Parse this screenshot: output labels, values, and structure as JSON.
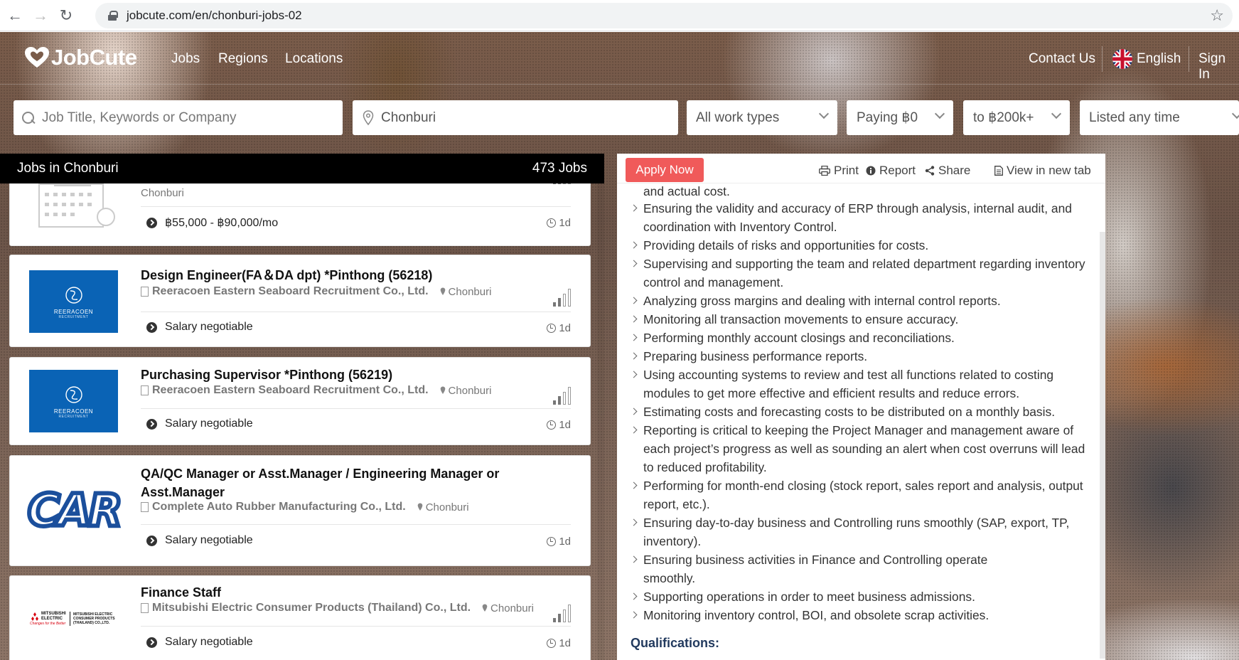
{
  "browser": {
    "url": "jobcute.com/en/chonburi-jobs-02",
    "back_icon": "←",
    "forward_icon": "→",
    "reload_icon": "↻",
    "star_icon": "☆"
  },
  "nav": {
    "brand": "JobCute",
    "links": [
      "Jobs",
      "Regions",
      "Locations"
    ],
    "contact": "Contact Us",
    "language": "English",
    "sign_in": "Sign In"
  },
  "search": {
    "keyword_placeholder": "Job Title, Keywords or Company",
    "location_value": "Chonburi",
    "work_type": "All work types",
    "pay_from": "Paying ฿0",
    "pay_to": "to ฿200k+",
    "listed": "Listed any time"
  },
  "list": {
    "header_title": "Jobs in Chonburi",
    "count": "473 Jobs",
    "jobs": [
      {
        "title": "",
        "company": "Chonburi",
        "location": "",
        "salary": "฿55,000 - ฿90,000/mo",
        "age": "1d"
      },
      {
        "title": "Design Engineer(FA＆DA dpt) *Pinthong (56218)",
        "company": "Reeracoen Eastern Seaboard Recruitment Co., Ltd.",
        "location": "Chonburi",
        "salary": "Salary negotiable",
        "age": "1d",
        "logo_text": "REERACOEN",
        "logo_sub": "RECRUITMENT"
      },
      {
        "title": "Purchasing Supervisor *Pinthong (56219)",
        "company": "Reeracoen Eastern Seaboard Recruitment Co., Ltd.",
        "location": "Chonburi",
        "salary": "Salary negotiable",
        "age": "1d",
        "logo_text": "REERACOEN",
        "logo_sub": "RECRUITMENT"
      },
      {
        "title": "QA/QC Manager or Asst.Manager / Engineering Manager or Asst.Manager",
        "company": "Complete Auto Rubber Manufacturing Co., Ltd.",
        "location": "Chonburi",
        "salary": "Salary negotiable",
        "age": "1d",
        "logo_text": "CAR"
      },
      {
        "title": "Finance Staff",
        "company": "Mitsubishi Electric Consumer Products (Thailand) Co., Ltd.",
        "location": "Chonburi",
        "salary": "Salary negotiable",
        "age": "1d",
        "logo_text": "MITSUBISHI ELECTRIC",
        "logo_sub": "Changes for the Better",
        "logo_side": "MITSUBISHI ELECTRIC CONSUMER PRODUCTS (THAILAND) CO.,LTD."
      }
    ]
  },
  "detail": {
    "apply": "Apply Now",
    "print": "Print",
    "report": "Report",
    "share": "Share",
    "new_tab": "View in new tab",
    "leading_text": "and actual cost.",
    "bullets": [
      "Ensuring the validity and accuracy of ERP through analysis, internal audit, and coordination with Inventory Control.",
      "Providing details of risks and opportunities for costs.",
      "Supervising and supporting the team and related department regarding inventory control and management.",
      "Analyzing gross margins and dealing with internal control reports.",
      "Monitoring all transaction movements to ensure accuracy.",
      "Performing monthly account closings and reconciliations.",
      "Preparing business performance reports.",
      "Using accounting systems to review and test all functions related to costing modules to get more effective and efficient results and reduce errors.",
      "Estimating costs and forecasting costs to be distributed on a monthly basis.",
      "Reporting is critical to keeping the Project Manager and management aware of each project’s progress as well as sounding an alert when cost overruns will lead to reduced profitability.",
      "Performing for month-end closing (stock report, sales report and analysis, output report, etc.).",
      "Ensuring day-to-day business and Controlling runs smoothly (SAP, export, TP, inventory).",
      "Ensuring business activities in Finance and Controlling operate smoothly.",
      "Supporting operations in order to meet business admissions.",
      "Monitoring inventory control, BOI, and obsolete scrap activities."
    ],
    "qualifications": "Qualifications:"
  },
  "colors": {
    "apply": "#f05a5a",
    "reeracoen_blue": "#0a63b5",
    "car_blue": "#1b4f9c",
    "mitsubishi_red": "#d7000f",
    "header_black": "#000000"
  }
}
